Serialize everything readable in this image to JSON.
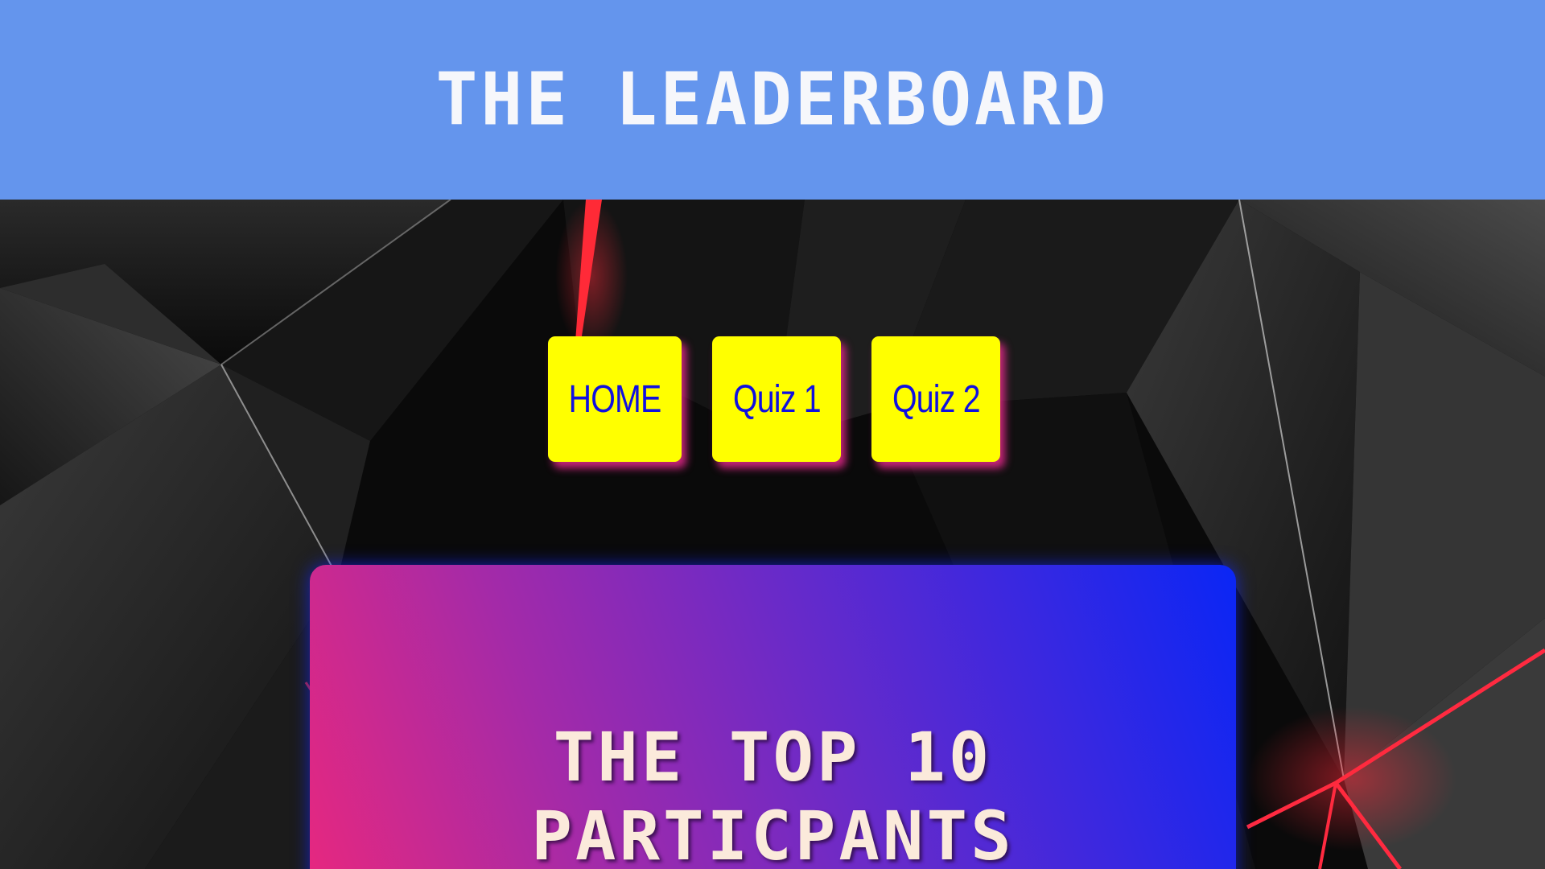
{
  "header": {
    "title": "THE LEADERBOARD"
  },
  "nav": {
    "home_label": "HOME",
    "quiz1_label": "Quiz 1",
    "quiz2_label": "Quiz 2"
  },
  "leaderboard_card": {
    "title_line1": "THE TOP 10",
    "title_line2": "PARTICPANTS"
  },
  "colors": {
    "header_bg": "#6495ed",
    "nav_button_bg": "#ffff00",
    "nav_button_text": "#1010e0",
    "nav_button_shadow": "#e6288c",
    "card_gradient_start": "#e8287e",
    "card_gradient_end": "#0a26f5",
    "card_title_text": "#fbeadb"
  }
}
